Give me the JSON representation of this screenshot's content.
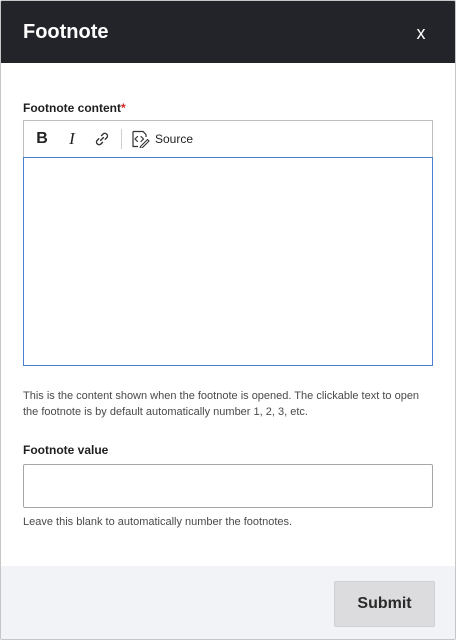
{
  "dialog": {
    "title": "Footnote",
    "close_label": "x"
  },
  "content_field": {
    "label": "Footnote content",
    "required_marker": "*",
    "toolbar": {
      "bold_label": "B",
      "italic_label": "I",
      "link_icon": "link-icon",
      "source_icon": "source-code-icon",
      "source_label": "Source"
    },
    "value": "",
    "description": "This is the content shown when the footnote is opened. The clickable text to open the footnote is by default automatically number 1, 2, 3, etc."
  },
  "value_field": {
    "label": "Footnote value",
    "value": "",
    "description": "Leave this blank to automatically number the footnotes."
  },
  "footer": {
    "submit_label": "Submit"
  },
  "colors": {
    "titlebar_bg": "#232429",
    "required": "#d72222",
    "editor_focus_border": "#4a7fd1",
    "footer_bg": "#f2f3f6",
    "submit_bg": "#dcdcde"
  }
}
